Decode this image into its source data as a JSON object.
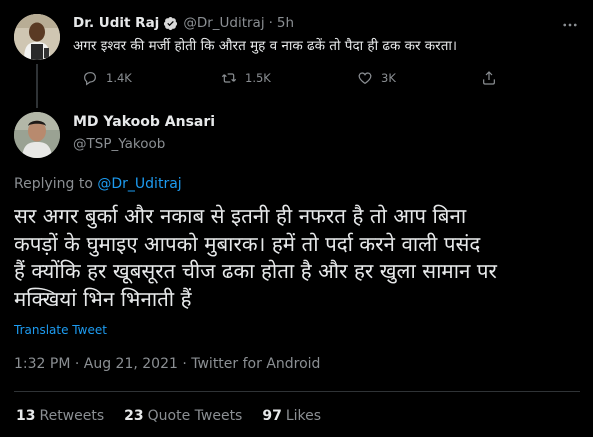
{
  "parent_tweet": {
    "author_name": "Dr. Udit Raj",
    "handle": "@Dr_Uditraj",
    "separator": "·",
    "time_ago": "5h",
    "text": "अगर इश्वर की मर्जी होती कि औरत मुह व नाक ढकें तो पैदा ही ढक कर  करता।",
    "reply_count": "1.4K",
    "retweet_count": "1.5K",
    "like_count": "3K"
  },
  "main_tweet": {
    "author_name": "MD Yakoob Ansari",
    "handle": "@TSP_Yakoob",
    "replying_prefix": "Replying to ",
    "replying_to": "@Dr_Uditraj",
    "body_lines": [
      "सर अगर बुर्का और नकाब से इतनी ही नफरत है तो आप बिना",
      "कपड़ों के घुमाइए आपको मुबारक। हमें तो पर्दा करने वाली पसंद",
      "हैं क्योंकि हर खूबसूरत चीज ढका होता है और हर खुला सामान पर",
      "मक्खियां भिन भिनाती हैं"
    ],
    "translate_label": "Translate Tweet",
    "timestamp": "1:32 PM · Aug 21, 2021 · Twitter for Android"
  },
  "stats": {
    "retweets_count": "13",
    "retweets_label": "Retweets",
    "quotes_count": "23",
    "quotes_label": "Quote Tweets",
    "likes_count": "97",
    "likes_label": "Likes"
  },
  "colors": {
    "background": "#000000",
    "text_primary": "#e7e9ea",
    "text_secondary": "#8b8f93",
    "accent": "#1d9bf0",
    "divider": "#2f3336"
  },
  "icons": [
    "verified-icon",
    "reply-icon",
    "retweet-icon",
    "like-icon",
    "share-icon",
    "more-icon"
  ]
}
